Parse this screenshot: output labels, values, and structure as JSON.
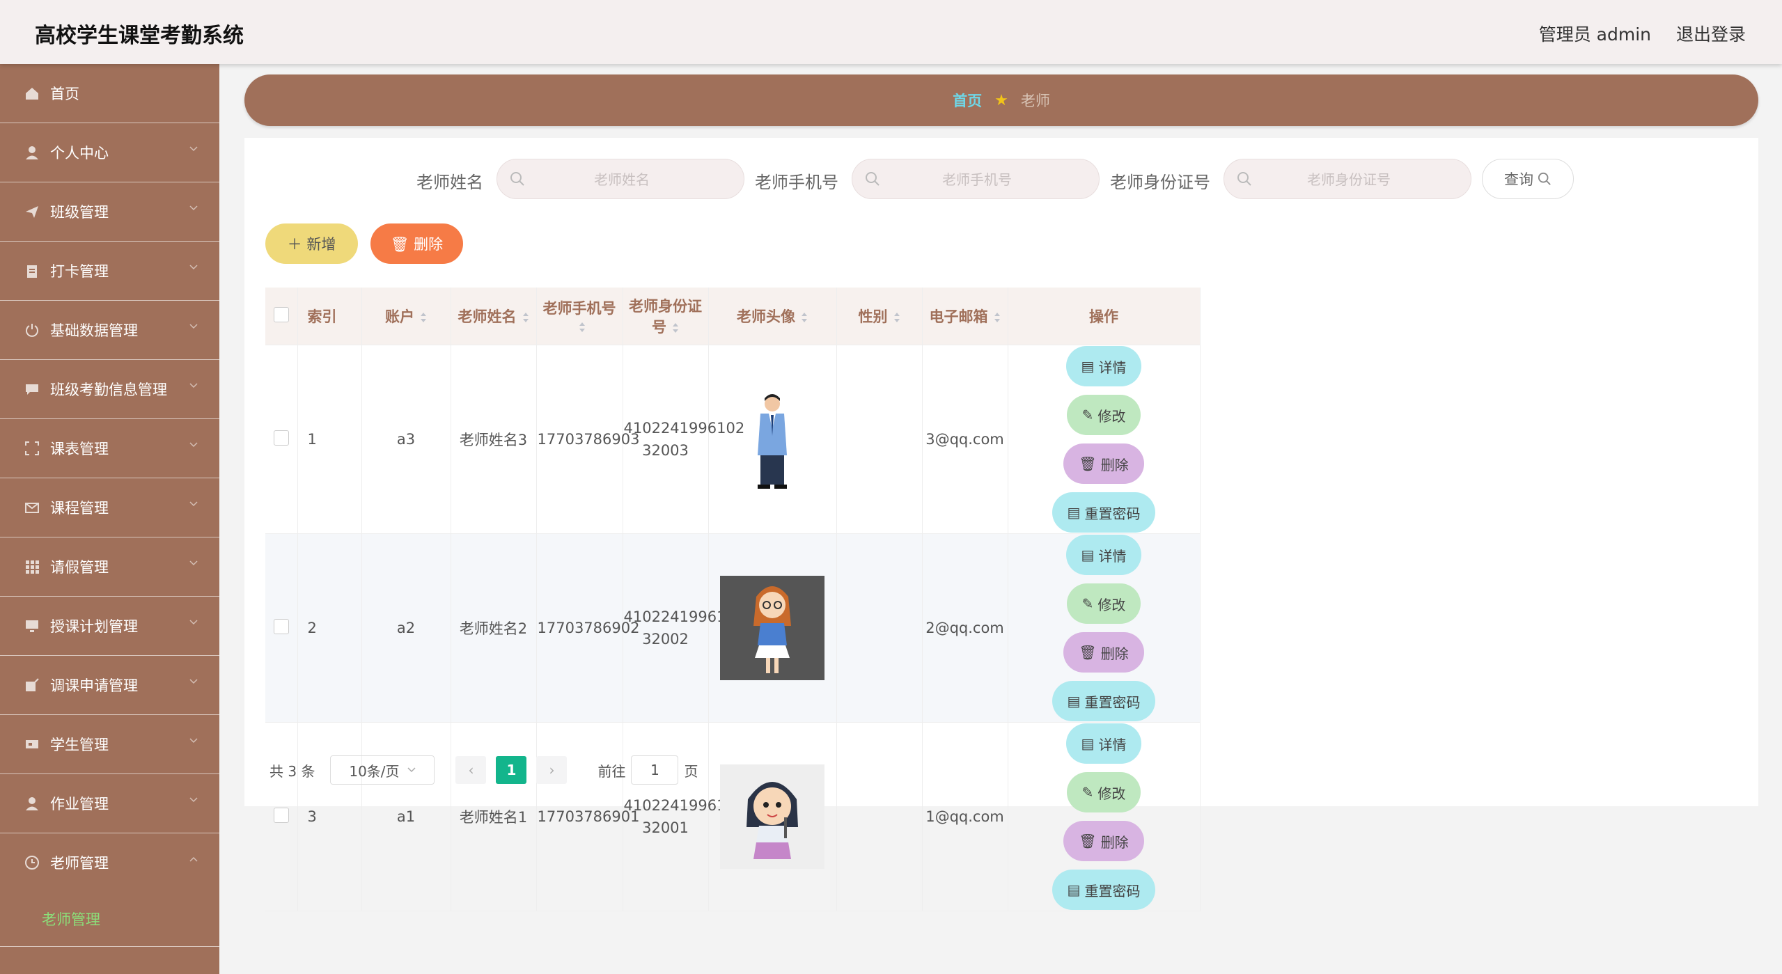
{
  "header": {
    "title": "高校学生课堂考勤系统",
    "user": "管理员 admin",
    "logout": "退出登录"
  },
  "sidebar": {
    "items": [
      {
        "label": "首页",
        "icon": "home-icon"
      },
      {
        "label": "个人中心",
        "icon": "person-icon"
      },
      {
        "label": "班级管理",
        "icon": "send-icon"
      },
      {
        "label": "打卡管理",
        "icon": "clipboard-icon"
      },
      {
        "label": "基础数据管理",
        "icon": "power-icon"
      },
      {
        "label": "班级考勤信息管理",
        "icon": "chat-icon"
      },
      {
        "label": "课表管理",
        "icon": "frame-icon"
      },
      {
        "label": "课程管理",
        "icon": "mail-icon"
      },
      {
        "label": "请假管理",
        "icon": "grid-icon"
      },
      {
        "label": "授课计划管理",
        "icon": "monitor-icon"
      },
      {
        "label": "调课申请管理",
        "icon": "edit-icon"
      },
      {
        "label": "学生管理",
        "icon": "ticket-icon"
      },
      {
        "label": "作业管理",
        "icon": "person-icon"
      },
      {
        "label": "老师管理",
        "icon": "clock-icon"
      }
    ],
    "submenu": "老师管理"
  },
  "breadcrumb": {
    "home": "首页",
    "current": "老师"
  },
  "search": {
    "name_label": "老师姓名",
    "name_placeholder": "老师姓名",
    "phone_label": "老师手机号",
    "phone_placeholder": "老师手机号",
    "id_label": "老师身份证号",
    "id_placeholder": "老师身份证号",
    "query": "查询"
  },
  "actions": {
    "add": "新增",
    "delete": "删除"
  },
  "table": {
    "headers": {
      "index": "索引",
      "account": "账户",
      "name": "老师姓名",
      "phone": "老师手机号",
      "idcard": "老师身份证号",
      "avatar": "老师头像",
      "gender": "性别",
      "email": "电子邮箱",
      "ops": "操作"
    },
    "rows": [
      {
        "index": "1",
        "account": "a3",
        "name": "老师姓名3",
        "phone": "17703786903",
        "id1": "4102241996102",
        "id2": "32003",
        "gender": "",
        "email": "3@qq.com"
      },
      {
        "index": "2",
        "account": "a2",
        "name": "老师姓名2",
        "phone": "17703786902",
        "id1": "4102241996102",
        "id2": "32002",
        "gender": "",
        "email": "2@qq.com"
      },
      {
        "index": "3",
        "account": "a1",
        "name": "老师姓名1",
        "phone": "17703786901",
        "id1": "4102241996102",
        "id2": "32001",
        "gender": "",
        "email": "1@qq.com"
      }
    ],
    "ops": {
      "detail": "详情",
      "edit": "修改",
      "delete": "删除",
      "reset": "重置密码"
    }
  },
  "pagination": {
    "total": "共 3 条",
    "size": "10条/页",
    "current": "1",
    "goto": "前往",
    "goto_value": "1",
    "page": "页"
  },
  "colors": {
    "brand": "#a0705a",
    "accent": "#13b58c",
    "submenu": "#8be07a"
  }
}
